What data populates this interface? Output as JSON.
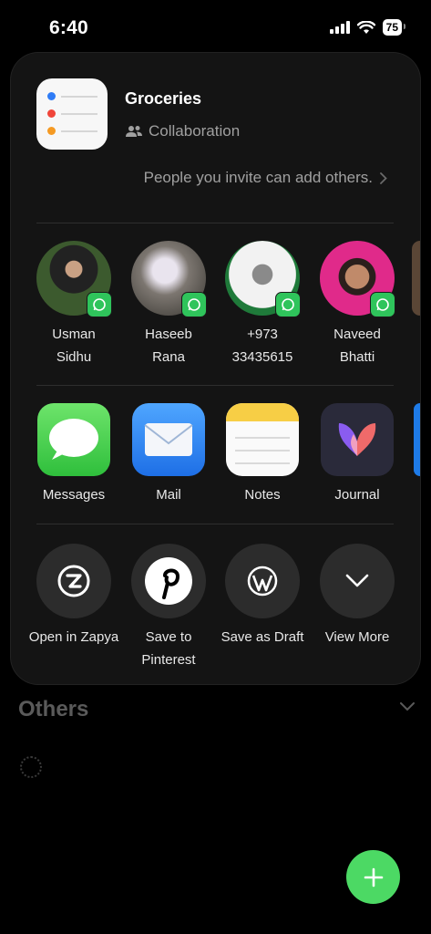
{
  "status": {
    "time": "6:40",
    "battery": "75"
  },
  "background": {
    "section_title": "Others"
  },
  "sheet": {
    "title": "Groceries",
    "subtitle": "Collaboration",
    "invite_text": "People you invite can add others."
  },
  "contacts": [
    {
      "line1": "Usman",
      "line2": "Sidhu"
    },
    {
      "line1": "Haseeb",
      "line2": "Rana"
    },
    {
      "line1": "+973",
      "line2": "33435615"
    },
    {
      "line1": "Naveed",
      "line2": "Bhatti"
    }
  ],
  "apps": [
    {
      "label": "Messages"
    },
    {
      "label": "Mail"
    },
    {
      "label": "Notes"
    },
    {
      "label": "Journal"
    }
  ],
  "actions": [
    {
      "line1": "Open in Zapya",
      "line2": ""
    },
    {
      "line1": "Save to",
      "line2": "Pinterest"
    },
    {
      "line1": "Save as Draft",
      "line2": ""
    },
    {
      "line1": "View More",
      "line2": ""
    }
  ],
  "colors": {
    "accent_green": "#4cd964",
    "whatsapp_green": "#2fc45b"
  }
}
